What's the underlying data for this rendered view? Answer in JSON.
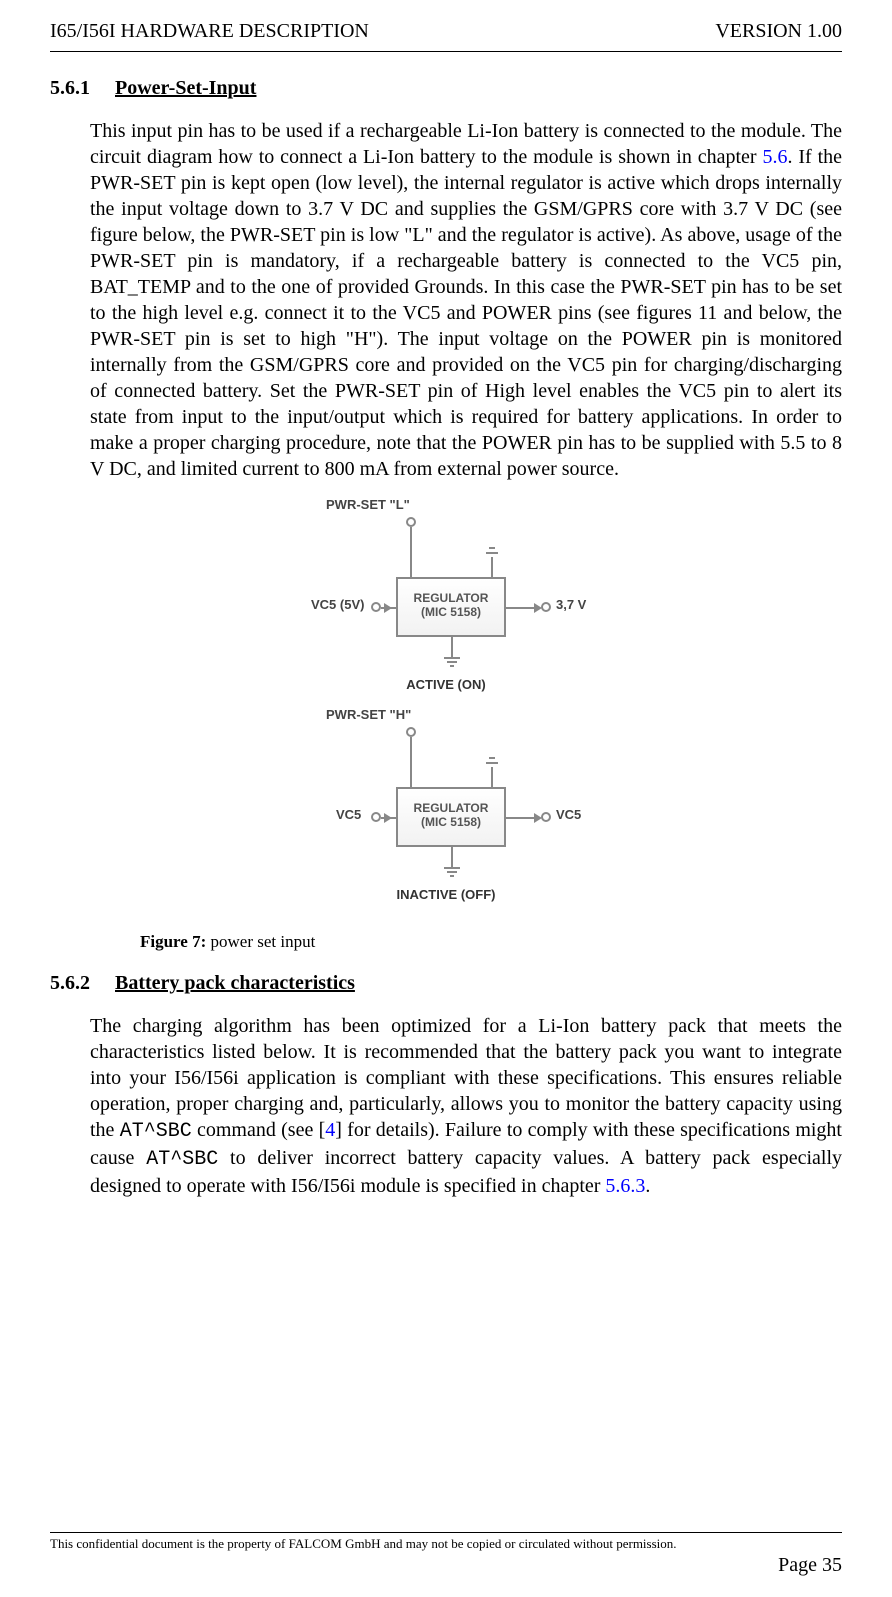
{
  "header": {
    "left": "I65/I56I HARDWARE DESCRIPTION",
    "right": "VERSION 1.00"
  },
  "section1": {
    "num": "5.6.1",
    "title": "Power-Set-Input",
    "para_pre": "This input pin has to be used if a rechargeable Li-Ion battery is connected to the module. The circuit diagram how to connect a Li-Ion battery to the module is shown in chapter ",
    "link1": "5.6",
    "para_post1": ". If the PWR-SET pin is kept open (low level), the internal regulator is active which drops internally the input voltage down to 3.7 V DC and supplies the GSM/GPRS core with 3.7 V DC (see figure below, the PWR-SET pin is low \"L\" and the regulator is active).",
    "para2": "As above, usage of the PWR-SET pin is mandatory, if a rechargeable battery is connected to the VC5 pin, BAT_TEMP and to the one of provided Grounds. In this case the PWR-SET pin has to be set to the high level e.g. connect it to the VC5 and POWER pins (see figures 11 and below, the PWR-SET pin is set to high \"H\"). The input voltage on the POWER pin is monitored internally from the GSM/GPRS core and provided on the VC5 pin for charging/discharging of connected battery. Set the PWR-SET pin of High level enables the VC5 pin to alert its state from input to the input/output which is required for battery applications. In order to make a proper charging procedure, note that the POWER pin has to be supplied with 5.5 to 8 V DC, and limited current to 800 mA from external power source."
  },
  "figure": {
    "pwrset_l": "PWR-SET \"L\"",
    "pwrset_h": "PWR-SET \"H\"",
    "vc5_5v": "VC5 (5V)",
    "v37": "3,7 V",
    "vc5": "VC5",
    "reg1": "REGULATOR",
    "reg2": "(MIC 5158)",
    "active": "ACTIVE (ON)",
    "inactive": "INACTIVE (OFF)",
    "caption_bold": "Figure 7: ",
    "caption_text": "power set input"
  },
  "section2": {
    "num": "5.6.2",
    "title": "Battery pack characteristics",
    "p1": "The charging algorithm has been optimized for a Li-Ion battery pack that meets the characteristics listed below. It is recommended that the battery pack you want to integrate into your I56/I56i application is compliant with these specifications. This ensures reliable operation, proper charging and, particularly, allows you to monitor the battery capacity using the ",
    "code1": "AT^SBC",
    "p2": " command (see [",
    "link4": "4",
    "p3": "] for details). Failure to comply with these specifications might cause ",
    "code2": "AT^SBC",
    "p4": " to deliver incorrect battery capacity values. A battery pack especially designed to operate with I56/I56i module is specified in chapter ",
    "link563": "5.6.3",
    "p5": "."
  },
  "footer": {
    "text": "This confidential document is the property of FALCOM GmbH and may not be copied or circulated without permission.",
    "page": "Page 35"
  }
}
